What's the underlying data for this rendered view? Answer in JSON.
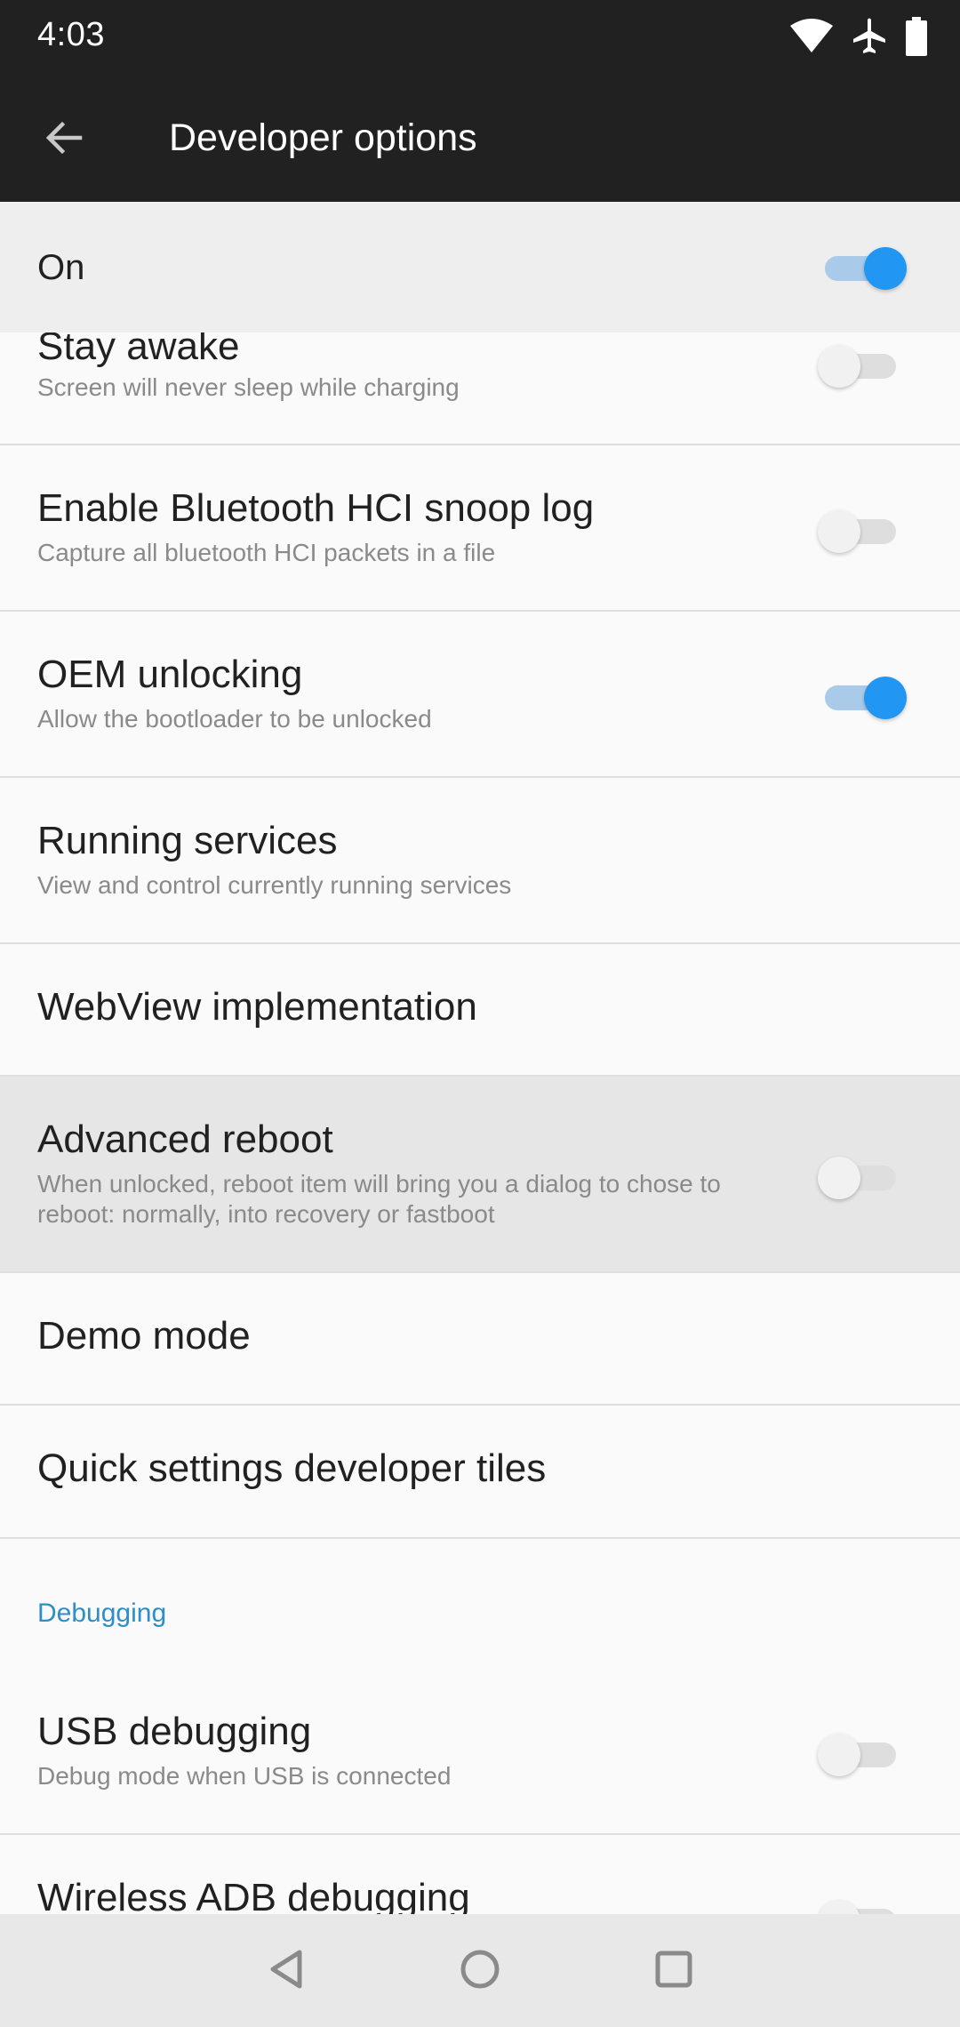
{
  "status_bar": {
    "time": "4:03",
    "icons": [
      "wifi-icon",
      "airplane-icon",
      "battery-icon"
    ]
  },
  "app_bar": {
    "back_icon": "arrow-left-icon",
    "title": "Developer options"
  },
  "master_switch": {
    "label": "On",
    "enabled": true
  },
  "settings": [
    {
      "title": "Stay awake",
      "summary": "Screen will never sleep while charging",
      "toggle": false
    },
    {
      "title": "Enable Bluetooth HCI snoop log",
      "summary": "Capture all bluetooth HCI packets in a file",
      "toggle": false
    },
    {
      "title": "OEM unlocking",
      "summary": "Allow the bootloader to be unlocked",
      "toggle": true
    },
    {
      "title": "Running services",
      "summary": "View and control currently running services"
    },
    {
      "title": "WebView implementation"
    },
    {
      "title": "Advanced reboot",
      "summary": "When unlocked, reboot item will bring you a dialog to chose to reboot: normally, into recovery or fastboot",
      "toggle": false
    },
    {
      "title": "Demo mode"
    },
    {
      "title": "Quick settings developer tiles"
    }
  ],
  "debugging": {
    "header": "Debugging",
    "items": [
      {
        "title": "USB debugging",
        "summary": "Debug mode when USB is connected",
        "toggle": false
      },
      {
        "title": "Wireless ADB debugging",
        "toggle": false
      }
    ]
  },
  "nav_bar": {
    "icons": [
      "back-triangle-icon",
      "home-circle-icon",
      "recents-square-icon"
    ]
  },
  "colors": {
    "app_bar": "#212121",
    "accent": "#2196f3",
    "section_header": "#2e8ec5"
  }
}
